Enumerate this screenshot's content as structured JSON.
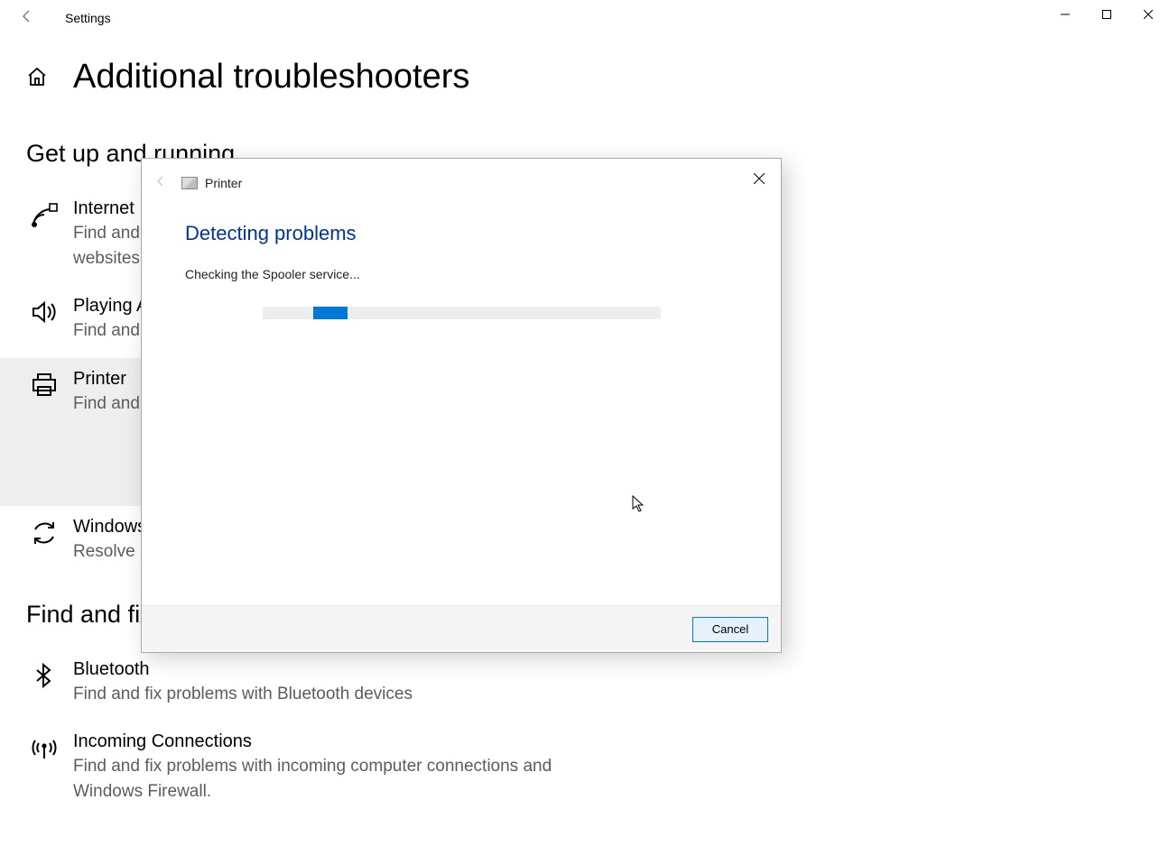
{
  "titlebar": {
    "app_title": "Settings"
  },
  "page": {
    "title": "Additional troubleshooters",
    "section1": "Get up and running",
    "section2": "Find and fix other problems"
  },
  "troubleshooters": {
    "internet": {
      "title": "Internet",
      "desc": "Find and fix problems with connecting to the Internet or to websites."
    },
    "audio": {
      "title": "Playing Audio",
      "desc": "Find and fix problems with playing sound."
    },
    "printer": {
      "title": "Printer",
      "desc": "Find and fix problems with printing."
    },
    "windows_update": {
      "title": "Windows Update",
      "desc": "Resolve problems that prevent you from updating Windows."
    },
    "bluetooth": {
      "title": "Bluetooth",
      "desc": "Find and fix problems with Bluetooth devices"
    },
    "incoming": {
      "title": "Incoming Connections",
      "desc": "Find and fix problems with incoming computer connections and Windows Firewall."
    }
  },
  "dialog": {
    "title": "Printer",
    "section_title": "Detecting problems",
    "status": "Checking the Spooler service...",
    "cancel": "Cancel"
  }
}
